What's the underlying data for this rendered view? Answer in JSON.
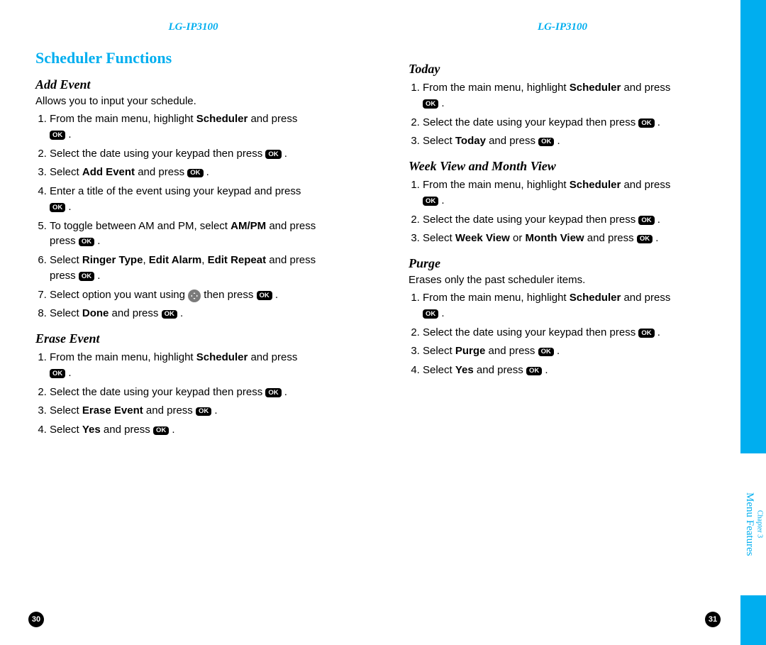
{
  "header": {
    "model": "LG-IP3100"
  },
  "icons": {
    "ok": "OK"
  },
  "pagenum": {
    "left": "30",
    "right": "31"
  },
  "sidetab": {
    "chapter": "Chapter 3",
    "title": "Menu Features"
  },
  "section_title": "Scheduler Functions",
  "add_event": {
    "title": "Add Event",
    "intro": "Allows you to input your schedule.",
    "s1a": "From the main menu, highlight ",
    "s1b": "Scheduler",
    "s1c": " and press ",
    "s2a": "Select the date using your keypad then press ",
    "s3a": "Select ",
    "s3b": "Add Event",
    "s3c": " and press ",
    "s4a": "Enter a title of the event using your keypad and press ",
    "s5a": "To toggle between AM and PM, select ",
    "s5b": "AM/PM",
    "s5c": " and press ",
    "s6a": "Select ",
    "s6b": "Ringer Type",
    "s6c": ", ",
    "s6d": "Edit Alarm",
    "s6e": ", ",
    "s6f": "Edit Repeat",
    "s6g": " and press ",
    "s7a": "Select option you want using ",
    "s7b": " then press ",
    "s8a": "Select ",
    "s8b": "Done",
    "s8c": " and press "
  },
  "erase_event": {
    "title": "Erase Event",
    "s1a": "From the main menu, highlight ",
    "s1b": "Scheduler",
    "s1c": " and press ",
    "s2a": "Select the date using your keypad then press ",
    "s3a": "Select ",
    "s3b": "Erase Event",
    "s3c": " and press ",
    "s4a": "Select ",
    "s4b": "Yes",
    "s4c": " and press "
  },
  "today": {
    "title": "Today",
    "s1a": "From the main menu, highlight ",
    "s1b": "Scheduler",
    "s1c": " and press ",
    "s2a": "Select the date using your keypad then press ",
    "s3a": "Select ",
    "s3b": "Today",
    "s3c": " and press "
  },
  "week_month": {
    "title": "Week View and Month View",
    "s1a": "From the main menu, highlight ",
    "s1b": "Scheduler",
    "s1c": " and press ",
    "s2a": "Select the date using your keypad then press ",
    "s3a": "Select ",
    "s3b": "Week View",
    "s3c": " or ",
    "s3d": "Month View",
    "s3e": " and press "
  },
  "purge": {
    "title": "Purge",
    "intro": "Erases only the past scheduler items.",
    "s1a": "From the main menu, highlight ",
    "s1b": "Scheduler",
    "s1c": " and press ",
    "s2a": "Select the date using your keypad then press ",
    "s3a": "Select ",
    "s3b": "Purge",
    "s3c": " and press ",
    "s4a": "Select ",
    "s4b": "Yes",
    "s4c": " and press "
  }
}
